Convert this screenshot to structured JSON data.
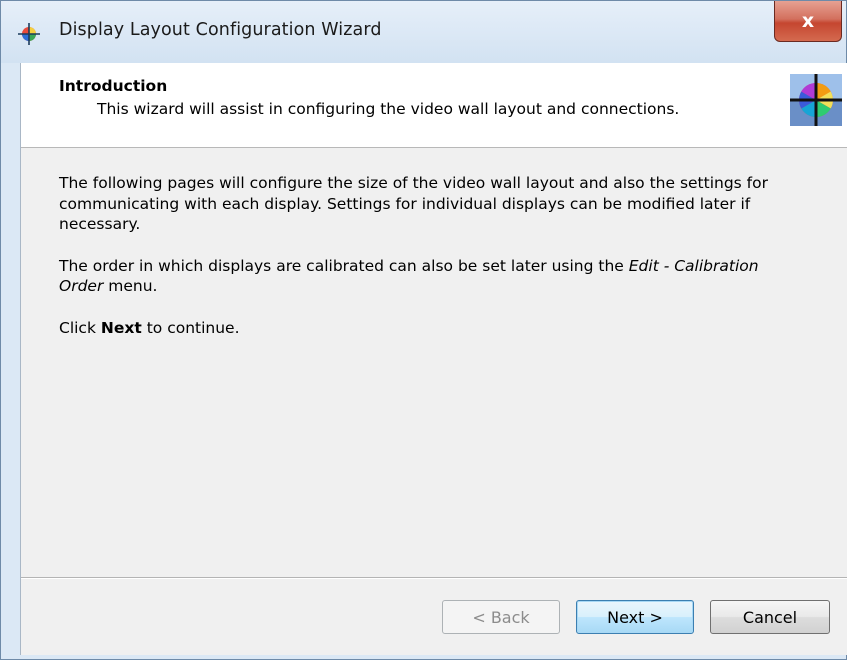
{
  "window": {
    "title": "Display Layout Configuration Wizard",
    "close_glyph": "x"
  },
  "header": {
    "title": "Introduction",
    "subtitle": "This wizard will assist in configuring the video wall layout and connections."
  },
  "body": {
    "para1": "The following pages will configure the size of the video wall layout and also the settings for communicating with each display. Settings for individual displays can be modified later if necessary.",
    "para2_pre": "The order in which displays are calibrated can also be set later using the ",
    "para2_menu": "Edit - Calibration Order",
    "para2_post": " menu.",
    "para3_pre": "Click ",
    "para3_bold": "Next",
    "para3_post": " to continue."
  },
  "buttons": {
    "back": "< Back",
    "next": "Next >",
    "cancel": "Cancel"
  },
  "icons": {
    "app": "color-wheel-icon",
    "header": "color-wheel-crosshair-icon"
  }
}
